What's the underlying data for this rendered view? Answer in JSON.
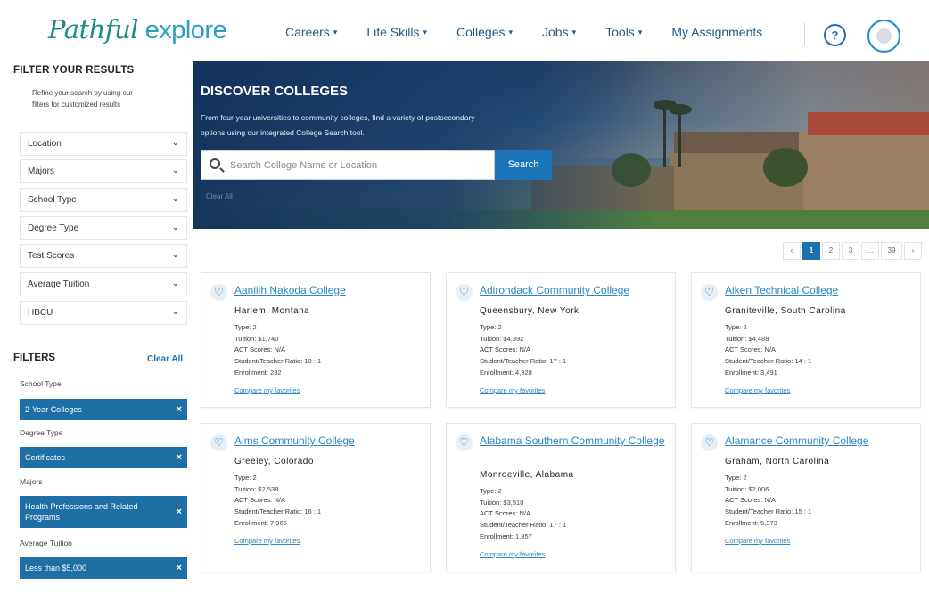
{
  "header": {
    "logo_part1": "Pathful",
    "logo_part2": " explore",
    "nav": [
      {
        "label": "Careers",
        "caret": "▾"
      },
      {
        "label": "Life Skills",
        "caret": "▾"
      },
      {
        "label": "Colleges",
        "caret": "▾"
      },
      {
        "label": "Jobs",
        "caret": "▾"
      },
      {
        "label": "Tools",
        "caret": "▾"
      },
      {
        "label": "My Assignments",
        "caret": ""
      }
    ],
    "help": "?"
  },
  "sidebar": {
    "title": "FILTER YOUR RESULTS",
    "description": "Refine your search by using our filters for customized results",
    "dropdowns": [
      "Location",
      "Majors",
      "School Type",
      "Degree Type",
      "Test Scores",
      "Average Tuition",
      "HBCU"
    ],
    "filters_heading": "FILTERS",
    "clear_all": "Clear All",
    "applied": [
      {
        "label": "School Type",
        "chip": "2-Year Colleges"
      },
      {
        "label": "Degree Type",
        "chip": "Certificates"
      },
      {
        "label": "Majors",
        "chip": "Health Professions and Related Programs"
      },
      {
        "label": "Average Tuition",
        "chip": "Less than $5,000"
      }
    ],
    "chip_close": "×"
  },
  "hero": {
    "title": "DISCOVER COLLEGES",
    "subtitle": "From four-year universities to community colleges, find a variety of postsecondary options using our integrated College Search tool.",
    "search_placeholder": "Search College Name or Location",
    "search_button": "Search",
    "clear": "Clear All"
  },
  "pagination": [
    "‹",
    "1",
    "2",
    "3",
    "...",
    "39",
    "›"
  ],
  "stat_labels": {
    "type": "Type:",
    "tuition": "Tuition:",
    "act": "ACT Scores:",
    "ratio": "Student/Teacher Ratio:",
    "enrollment": "Enrollment:"
  },
  "compare_label": "Compare my favorites",
  "heart": "♡",
  "colleges": [
    {
      "name": "Aaniiih Nakoda College",
      "location": "Harlem, Montana",
      "type": "2",
      "tuition": "$1,740",
      "act": "N/A",
      "ratio": "10 : 1",
      "enrollment": "282"
    },
    {
      "name": "Adirondack Community College",
      "location": "Queensbury, New York",
      "type": "2",
      "tuition": "$4,392",
      "act": "N/A",
      "ratio": "17 : 1",
      "enrollment": "4,928"
    },
    {
      "name": "Aiken Technical College",
      "location": "Graniteville, South Carolina",
      "type": "2",
      "tuition": "$4,488",
      "act": "N/A",
      "ratio": "14 : 1",
      "enrollment": "3,491"
    },
    {
      "name": "Aims Community College",
      "location": "Greeley, Colorado",
      "type": "2",
      "tuition": "$2,538",
      "act": "N/A",
      "ratio": "16 : 1",
      "enrollment": "7,966"
    },
    {
      "name": "Alabama Southern Community College",
      "location": "Monroeville, Alabama",
      "type": "2",
      "tuition": "$3,510",
      "act": "N/A",
      "ratio": "17 : 1",
      "enrollment": "1,857"
    },
    {
      "name": "Alamance Community College",
      "location": "Graham, North Carolina",
      "type": "2",
      "tuition": "$2,006",
      "act": "N/A",
      "ratio": "15 : 1",
      "enrollment": "5,373"
    }
  ]
}
